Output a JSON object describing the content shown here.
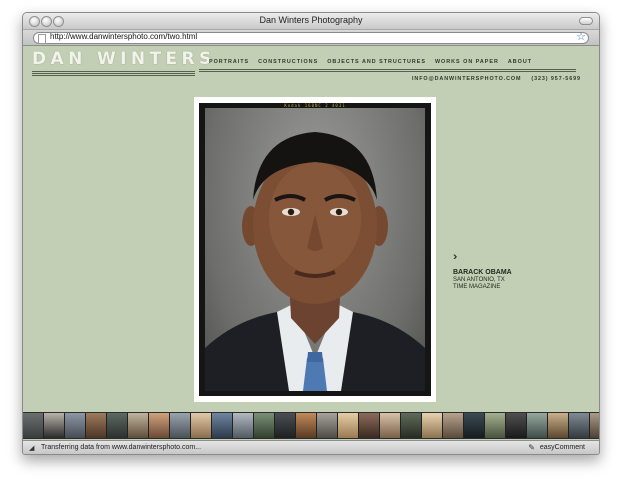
{
  "window": {
    "title": "Dan Winters Photography"
  },
  "address": {
    "url": "http://www.danwintersphoto.com/two.html"
  },
  "site": {
    "logo": "DAN WINTERS",
    "nav": [
      {
        "label": "PORTRAITS"
      },
      {
        "label": "CONSTRUCTIONS"
      },
      {
        "label": "OBJECTS AND STRUCTURES"
      },
      {
        "label": "WORKS ON PAPER"
      },
      {
        "label": "ABOUT"
      }
    ],
    "email": "INFO@DANWINTERSPHOTO.COM",
    "phone": "(323) 957-5699"
  },
  "photo": {
    "film_edge_text": "Kodak 160NC 2 4031",
    "caption_name": "BARACK OBAMA",
    "caption_location": "SAN ANTONIO, TX",
    "caption_publication": "TIME MAGAZINE"
  },
  "icons": {
    "next": "chevron-double-right-icon",
    "bookmark": "star-icon",
    "page": "document-icon"
  },
  "status": {
    "text": "Transferring data from www.danwintersphoto.com...",
    "extension": "easyComment"
  },
  "colors": {
    "page_background": "#c3cfb4",
    "text_dark": "#2e3a2a",
    "logo": "#f2f4ec"
  }
}
